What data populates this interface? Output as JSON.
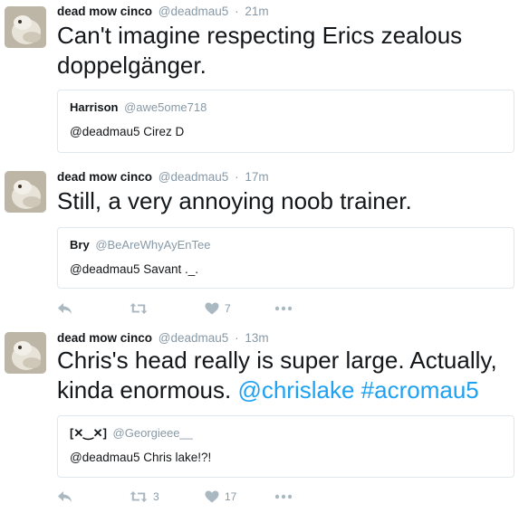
{
  "tweets": [
    {
      "author": {
        "name": "dead mow cinco",
        "handle": "@deadmau5"
      },
      "dot": "·",
      "time": "21m",
      "text": "Can't imagine respecting Erics zealous doppelgänger.",
      "quote": {
        "name": "Harrison",
        "handle": "@awe5ome718",
        "text": "@deadmau5 Cirez D"
      }
    },
    {
      "author": {
        "name": "dead mow cinco",
        "handle": "@deadmau5"
      },
      "dot": "·",
      "time": "17m",
      "text": "Still, a very annoying noob trainer.",
      "quote": {
        "name": "Bry",
        "handle": "@BeAreWhyAyEnTee",
        "text": "@deadmau5 Savant ._."
      },
      "actions": {
        "retweets": "",
        "likes": "7"
      }
    },
    {
      "author": {
        "name": "dead mow cinco",
        "handle": "@deadmau5"
      },
      "dot": "·",
      "time": "13m",
      "text_plain": "Chris's head really is super large. Actually, kinda enormous. ",
      "mention": "@chrislake",
      "hashtag": "#acromau5",
      "quote": {
        "name": "[✕‿✕]",
        "handle": "@Georgieee__",
        "text": "@deadmau5 Chris lake!?!"
      },
      "actions": {
        "retweets": "3",
        "likes": "17"
      }
    }
  ],
  "colors": {
    "link": "#1da1f2",
    "muted": "#8899a6",
    "icon": "#aab8c2",
    "border": "#e1e8ed"
  },
  "icons": [
    "avatar",
    "reply-icon",
    "retweet-icon",
    "like-icon",
    "more-icon"
  ]
}
